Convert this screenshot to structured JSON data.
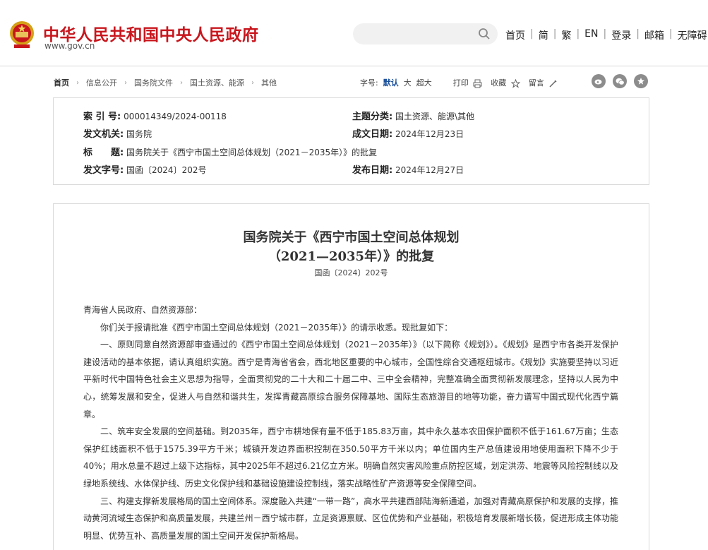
{
  "header": {
    "site_title": "中华人民共和国中央人民政府",
    "site_url": "www.gov.cn",
    "search_placeholder": "",
    "links": [
      "首页",
      "简",
      "繁",
      "EN",
      "登录",
      "邮箱",
      "无障碍"
    ]
  },
  "breadcrumb": [
    "首页",
    "信息公开",
    "国务院文件",
    "国土资源、能源",
    "其他"
  ],
  "tools": {
    "font_label": "字号:",
    "font_default": "默认",
    "font_large": "大",
    "font_xlarge": "超大",
    "print": "打印",
    "favorite": "收藏",
    "comment": "留言"
  },
  "meta": {
    "index_label": "索 引 号:",
    "index_value": "000014349/2024-00118",
    "topic_label": "主题分类:",
    "topic_value": "国土资源、能源\\其他",
    "issuer_label": "发文机关:",
    "issuer_value": "国务院",
    "date_written_label": "成文日期:",
    "date_written_value": "2024年12月23日",
    "title_label": "标　　题:",
    "title_value": "国务院关于《西宁市国土空间总体规划（2021－2035年）》的批复",
    "doc_no_label": "发文字号:",
    "doc_no_value": "国函〔2024〕202号",
    "publish_label": "发布日期:",
    "publish_value": "2024年12月27日"
  },
  "article": {
    "title_line1": "国务院关于《西宁市国土空间总体规划",
    "title_line2": "（2021—2035年）》的批复",
    "doc_no": "国函〔2024〕202号",
    "paragraphs": [
      "青海省人民政府、自然资源部：",
      "你们关于报请批准《西宁市国土空间总体规划（2021－2035年）》的请示收悉。现批复如下：",
      "一、原则同意自然资源部审查通过的《西宁市国土空间总体规划（2021－2035年）》（以下简称《规划》）。《规划》是西宁市各类开发保护建设活动的基本依据，请认真组织实施。西宁是青海省省会，西北地区重要的中心城市，全国性综合交通枢纽城市。《规划》实施要坚持以习近平新时代中国特色社会主义思想为指导，全面贯彻党的二十大和二十届二中、三中全会精神，完整准确全面贯彻新发展理念，坚持以人民为中心，统筹发展和安全，促进人与自然和谐共生，发挥青藏高原综合服务保障基地、国际生态旅游目的地等功能，奋力谱写中国式现代化西宁篇章。",
      "二、筑牢安全发展的空间基础。到2035年，西宁市耕地保有量不低于185.83万亩，其中永久基本农田保护面积不低于161.67万亩；生态保护红线面积不低于1575.39平方千米；城镇开发边界面积控制在350.50平方千米以内；单位国内生产总值建设用地使用面积下降不少于40%；用水总量不超过上级下达指标，其中2025年不超过6.21亿立方米。明确自然灾害风险重点防控区域，划定洪涝、地震等风险控制线以及绿地系统线、水体保护线、历史文化保护线和基础设施建设控制线，落实战略性矿产资源等安全保障空间。",
      "三、构建支撑新发展格局的国土空间体系。深度融入共建“一带一路”，高水平共建西部陆海新通道，加强对青藏高原保护和发展的支撑，推动黄河流域生态保护和高质量发展，共建兰州－西宁城市群，立足资源禀赋、区位优势和产业基础，积极培育发展新增长极，促进形成主体功能明显、优势互补、高质量发展的国土空间开发保护新格局。"
    ]
  },
  "colors": {
    "brand_red": "#c8161d",
    "accent_blue": "#1a4f9c"
  }
}
